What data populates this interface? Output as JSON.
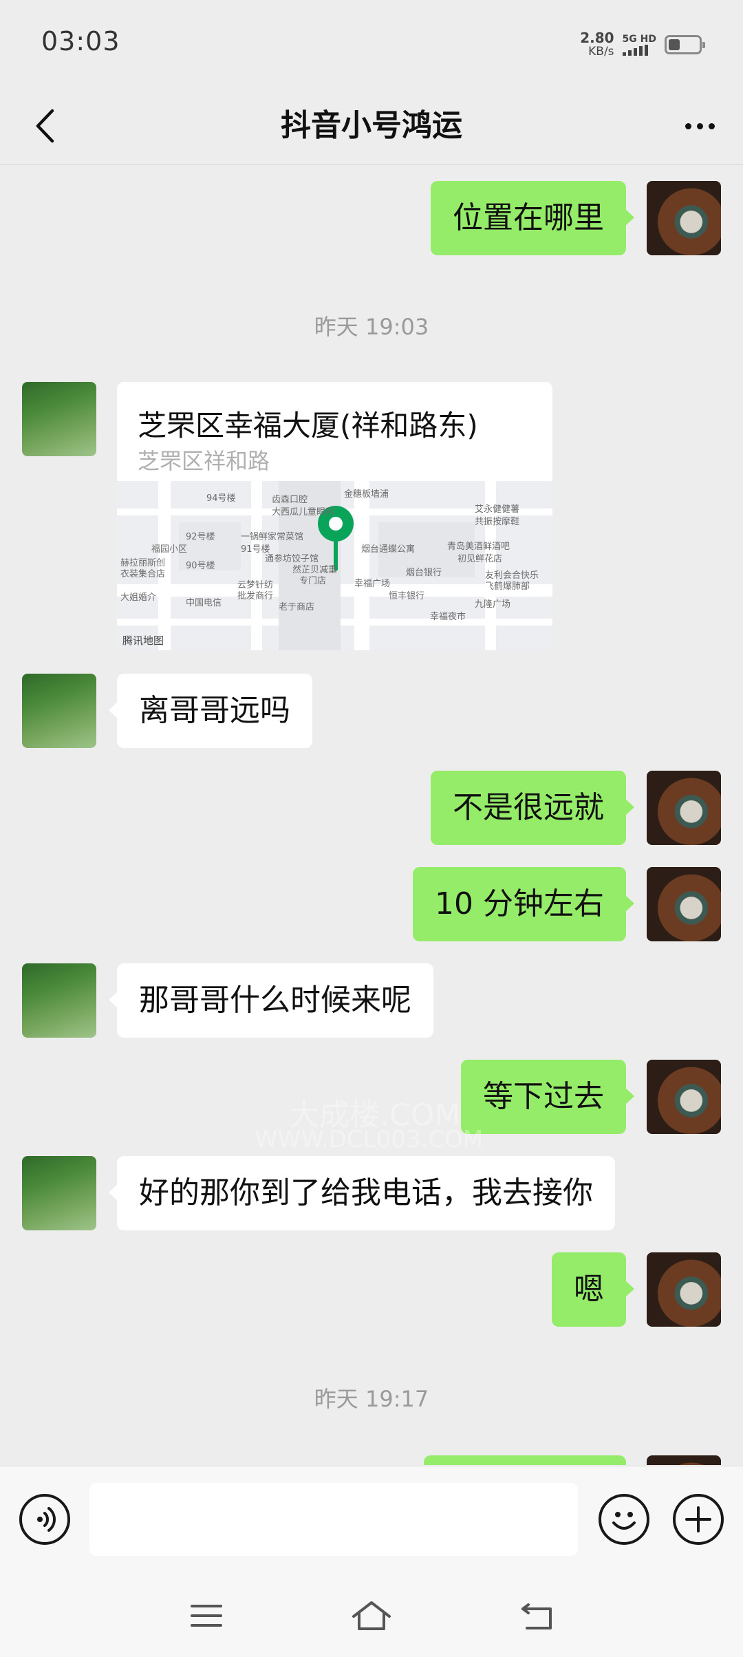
{
  "status": {
    "time": "03:03",
    "net_speed": "2.80",
    "net_unit": "KB/s",
    "network": "5G HD"
  },
  "header": {
    "title": "抖音小号鸿运"
  },
  "messages": [
    {
      "side": "right",
      "type": "text",
      "text": "位置在哪里"
    },
    {
      "type": "time",
      "text": "昨天 19:03"
    },
    {
      "side": "left",
      "type": "location",
      "title": "芝罘区幸福大厦(祥和路东)",
      "subtitle": "芝罘区祥和路",
      "map_provider": "腾讯地图"
    },
    {
      "side": "left",
      "type": "text",
      "text": "离哥哥远吗"
    },
    {
      "side": "right",
      "type": "text",
      "text": "不是很远就"
    },
    {
      "side": "right",
      "type": "text",
      "text": "10 分钟左右"
    },
    {
      "side": "left",
      "type": "text",
      "text": "那哥哥什么时候来呢"
    },
    {
      "side": "right",
      "type": "text",
      "text": "等下过去"
    },
    {
      "side": "left",
      "type": "text",
      "text": "好的那你到了给我电话，我去接你"
    },
    {
      "side": "right",
      "type": "text",
      "text": "嗯"
    },
    {
      "type": "time",
      "text": "昨天 19:17"
    }
  ],
  "map_labels": [
    "94号楼",
    "齿森口腔",
    "金穗板墙浦",
    "大西瓜儿童眼科",
    "艾永健健薯",
    "共振按摩鞋",
    "92号楼",
    "一锅鲜家常菜馆",
    "青岛美酒鲜酒吧",
    "福园小区",
    "91号楼",
    "烟台通蝶公寓",
    "初见鲜花店",
    "90号楼",
    "通参坊饺子馆",
    "赫拉丽斯创",
    "衣装集合店",
    "然芷贝减重",
    "专门店",
    "烟台银行",
    "友利会合快乐",
    "飞鹤爆肺部",
    "云梦针纺",
    "批发商行",
    "幸福广场",
    "恒丰银行",
    "大姐婚介",
    "中国电信",
    "老于商店",
    "九隆广场",
    "幸福夜市"
  ],
  "input": {
    "placeholder": ""
  },
  "watermark": {
    "line1": "大成楼.COM",
    "line2": "WWW.DCL003.COM"
  },
  "colors": {
    "self_bubble": "#95ec69",
    "other_bubble": "#ffffff",
    "background": "#ededed",
    "pin": "#0aa35a"
  }
}
